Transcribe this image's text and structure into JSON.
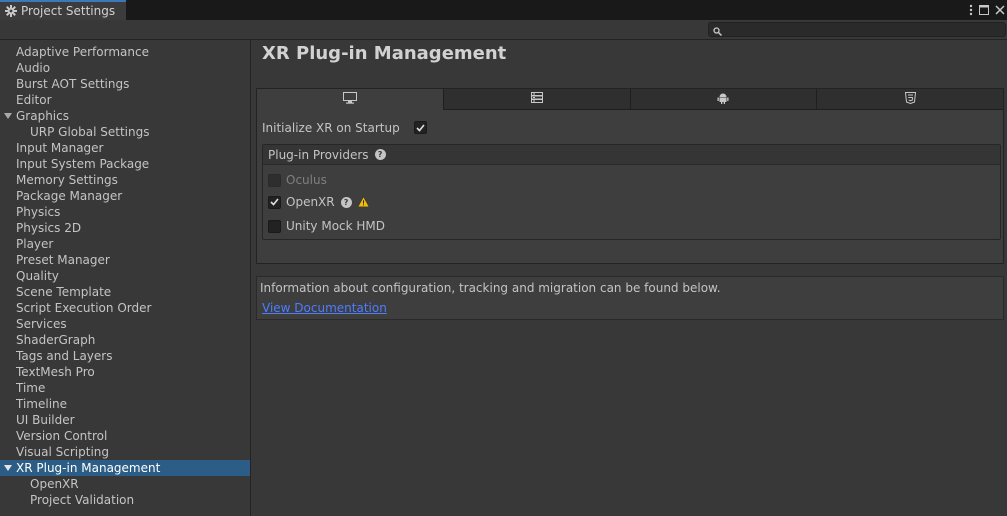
{
  "window": {
    "tab_title": "Project Settings",
    "icons": [
      "gear-icon",
      "more-vertical-icon",
      "maximize-icon",
      "close-icon"
    ]
  },
  "search": {
    "placeholder": "",
    "value": ""
  },
  "sidebar": {
    "items": [
      {
        "label": "Adaptive Performance",
        "level": 0
      },
      {
        "label": "Audio",
        "level": 0
      },
      {
        "label": "Burst AOT Settings",
        "level": 0
      },
      {
        "label": "Editor",
        "level": 0
      },
      {
        "label": "Graphics",
        "level": 0,
        "expanded": true
      },
      {
        "label": "URP Global Settings",
        "level": 1
      },
      {
        "label": "Input Manager",
        "level": 0
      },
      {
        "label": "Input System Package",
        "level": 0
      },
      {
        "label": "Memory Settings",
        "level": 0
      },
      {
        "label": "Package Manager",
        "level": 0
      },
      {
        "label": "Physics",
        "level": 0
      },
      {
        "label": "Physics 2D",
        "level": 0
      },
      {
        "label": "Player",
        "level": 0
      },
      {
        "label": "Preset Manager",
        "level": 0
      },
      {
        "label": "Quality",
        "level": 0
      },
      {
        "label": "Scene Template",
        "level": 0
      },
      {
        "label": "Script Execution Order",
        "level": 0
      },
      {
        "label": "Services",
        "level": 0
      },
      {
        "label": "ShaderGraph",
        "level": 0
      },
      {
        "label": "Tags and Layers",
        "level": 0
      },
      {
        "label": "TextMesh Pro",
        "level": 0
      },
      {
        "label": "Time",
        "level": 0
      },
      {
        "label": "Timeline",
        "level": 0
      },
      {
        "label": "UI Builder",
        "level": 0
      },
      {
        "label": "Version Control",
        "level": 0
      },
      {
        "label": "Visual Scripting",
        "level": 0
      },
      {
        "label": "XR Plug-in Management",
        "level": 0,
        "expanded": true,
        "selected": true
      },
      {
        "label": "OpenXR",
        "level": 1
      },
      {
        "label": "Project Validation",
        "level": 1
      }
    ]
  },
  "main": {
    "title": "XR Plug-in Management",
    "platform_tabs": [
      {
        "icon": "desktop-icon",
        "active": true
      },
      {
        "icon": "server-icon",
        "active": false
      },
      {
        "icon": "android-icon",
        "active": false
      },
      {
        "icon": "html5-icon",
        "active": false
      }
    ],
    "initialize_label": "Initialize XR on Startup",
    "initialize_checked": true,
    "providers": {
      "header": "Plug-in Providers",
      "items": [
        {
          "label": "Oculus",
          "checked": false,
          "disabled": true
        },
        {
          "label": "OpenXR",
          "checked": true,
          "help": true,
          "warning": true
        },
        {
          "label": "Unity Mock HMD",
          "checked": false
        }
      ]
    },
    "info": {
      "text": "Information about configuration, tracking and migration can be found below.",
      "link": "View Documentation"
    }
  },
  "colors": {
    "selection": "#2c5d87",
    "link": "#4c7eff",
    "warning": "#f4bc02",
    "tab_accent": "#3a79bb"
  }
}
